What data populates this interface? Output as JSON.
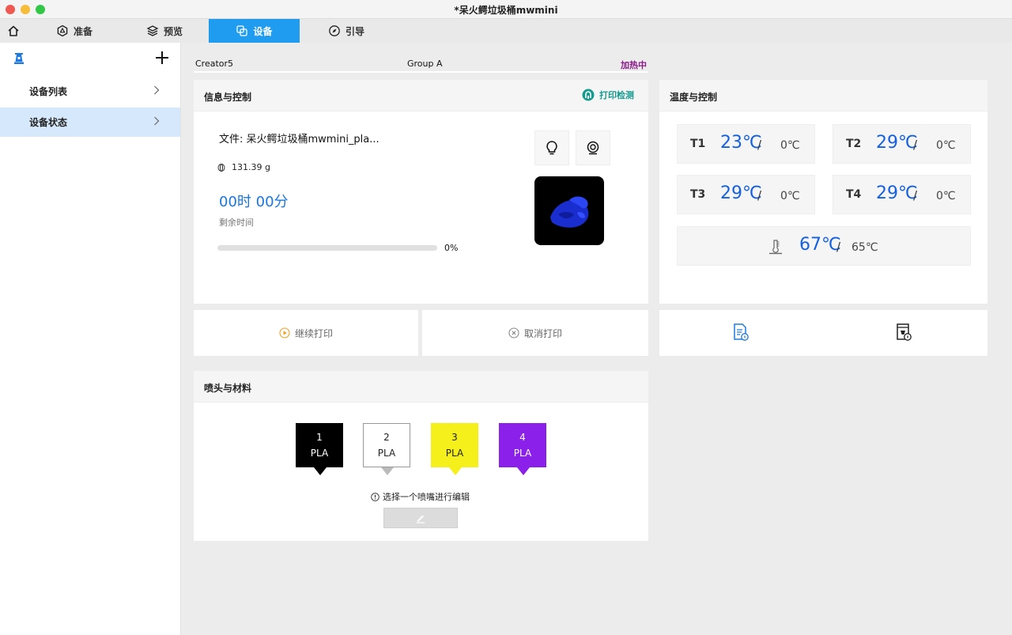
{
  "window": {
    "title": "*呆火鳄垃圾桶mwmini"
  },
  "tabs": [
    {
      "label": "准备",
      "icon": "hexagon-icon"
    },
    {
      "label": "预览",
      "icon": "layers-icon"
    },
    {
      "label": "设备",
      "icon": "device-icon",
      "active": true
    },
    {
      "label": "引导",
      "icon": "compass-icon"
    }
  ],
  "sidebar": {
    "items": [
      {
        "label": "设备列表"
      },
      {
        "label": "设备状态",
        "selected": true
      }
    ]
  },
  "device_header": {
    "name": "Creator5",
    "group": "Group A",
    "status": "加热中",
    "status_color": "#8a1a8a"
  },
  "info_panel": {
    "title": "信息与控制",
    "print_check": "打印检测",
    "file": "文件: 呆火鳄垃圾桶mwmini_pla...",
    "weight": "131.39 g",
    "remaining_time": "00时 00分",
    "remaining_label": "剩余时间",
    "progress_text": "0%",
    "progress": 0
  },
  "actions": {
    "resume": "继续打印",
    "cancel": "取消打印"
  },
  "temp_panel": {
    "title": "温度与控制",
    "nozzles": [
      {
        "name": "T1",
        "current": "23℃",
        "target": "0℃"
      },
      {
        "name": "T2",
        "current": "29℃",
        "target": "0℃"
      },
      {
        "name": "T3",
        "current": "29℃",
        "target": "0℃"
      },
      {
        "name": "T4",
        "current": "29℃",
        "target": "0℃"
      }
    ],
    "bed": {
      "current": "67℃",
      "target": "65℃"
    },
    "slash": "/"
  },
  "nozzle_panel": {
    "title": "喷头与材料",
    "materials": [
      {
        "number": "1",
        "type": "PLA",
        "color": "#000000",
        "text_color": "#ffffff"
      },
      {
        "number": "2",
        "type": "PLA",
        "color": "#ffffff",
        "text_color": "#222222"
      },
      {
        "number": "3",
        "type": "PLA",
        "color": "#f5f01c",
        "text_color": "#222222"
      },
      {
        "number": "4",
        "type": "PLA",
        "color": "#8b20ea",
        "text_color": "#ffffff"
      }
    ],
    "hint": "选择一个喷嘴进行编辑"
  },
  "colors": {
    "accent": "#1f9bf0",
    "temp_value": "#1460e0",
    "print_check": "#159a8f"
  }
}
